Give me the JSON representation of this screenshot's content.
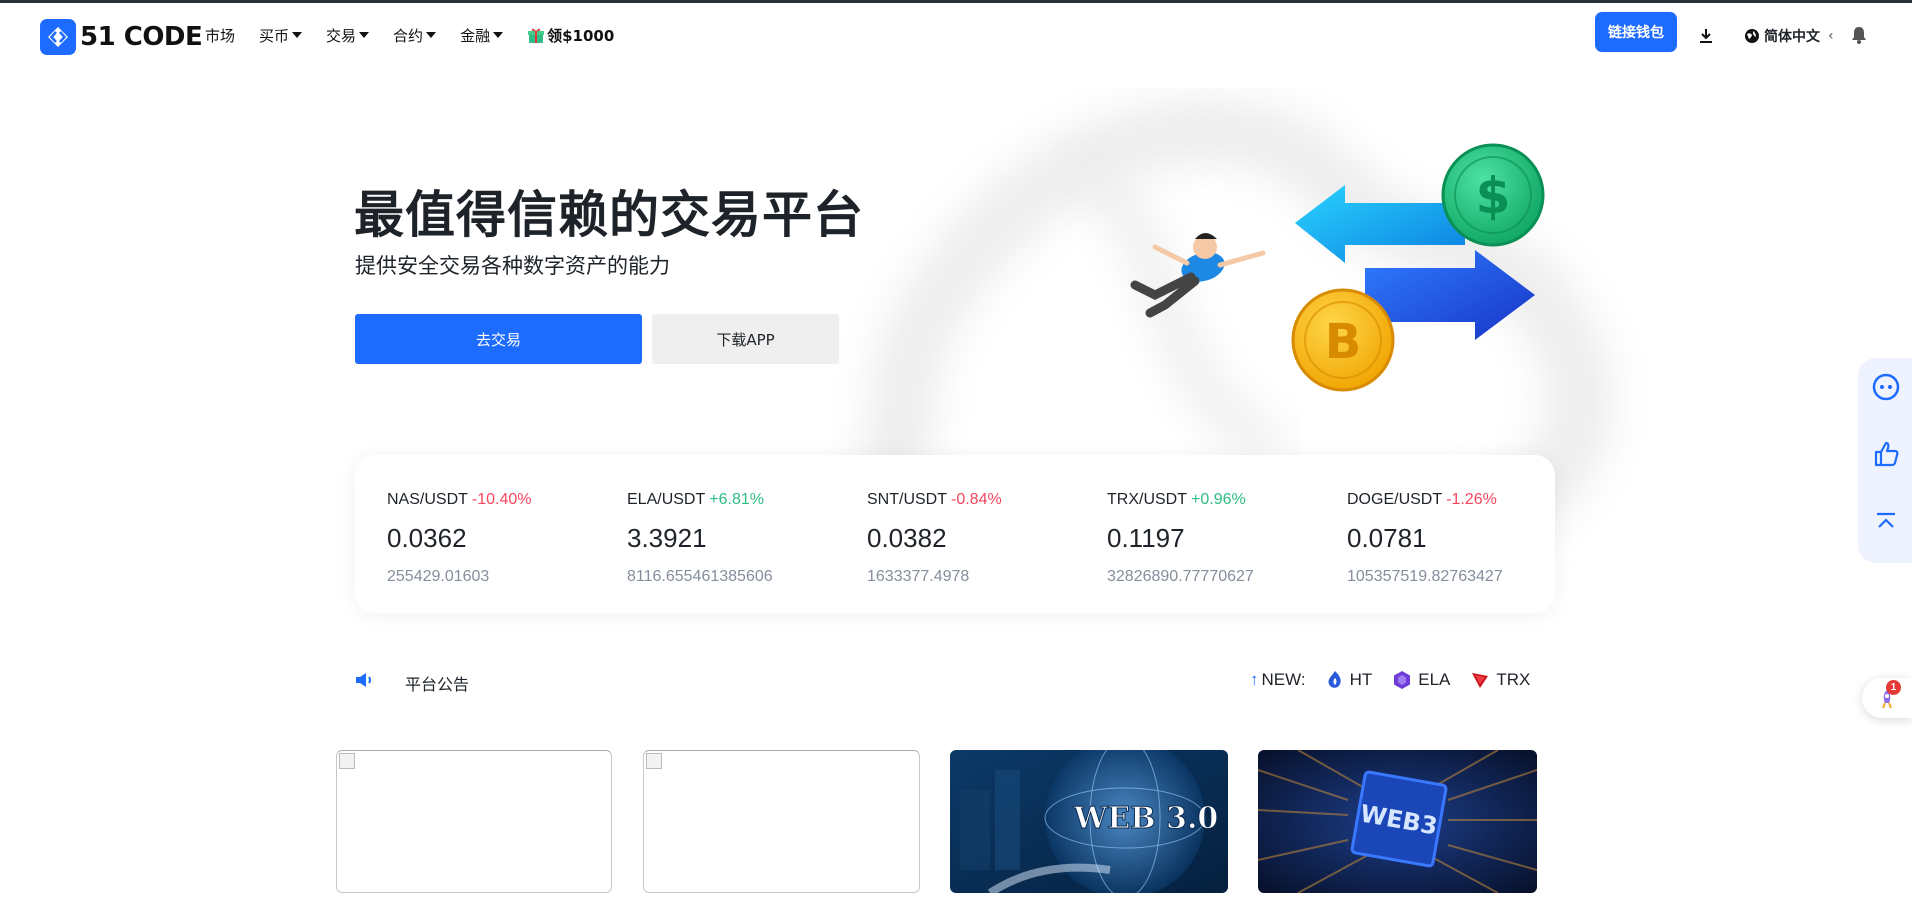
{
  "header": {
    "logo_text": "51 CODE",
    "nav": [
      {
        "label": "市场",
        "dropdown": false
      },
      {
        "label": "买币",
        "dropdown": true
      },
      {
        "label": "交易",
        "dropdown": true
      },
      {
        "label": "合约",
        "dropdown": true
      },
      {
        "label": "金融",
        "dropdown": true
      }
    ],
    "promo_label": "领$1000",
    "connect_wallet": "链接钱包",
    "language": "简体中文",
    "language_arrow": "‹"
  },
  "hero": {
    "title": "最值得信赖的交易平台",
    "subtitle": "提供安全交易各种数字资产的能力",
    "primary_button": "去交易",
    "secondary_button": "下载APP"
  },
  "tickers": [
    {
      "pair": "NAS/USDT",
      "change": "-10.40%",
      "direction": "down",
      "price": "0.0362",
      "volume": "255429.01603"
    },
    {
      "pair": "ELA/USDT",
      "change": "+6.81%",
      "direction": "up",
      "price": "3.3921",
      "volume": "8116.655461385606"
    },
    {
      "pair": "SNT/USDT",
      "change": "-0.84%",
      "direction": "down",
      "price": "0.0382",
      "volume": "1633377.4978"
    },
    {
      "pair": "TRX/USDT",
      "change": "+0.96%",
      "direction": "up",
      "price": "0.1197",
      "volume": "32826890.77770627"
    },
    {
      "pair": "DOGE/USDT",
      "change": "-1.26%",
      "direction": "down",
      "price": "0.0781",
      "volume": "105357519.82763427"
    }
  ],
  "announcement": {
    "label": "平台公告",
    "new_label": "NEW:",
    "new_coins": [
      "HT",
      "ELA",
      "TRX"
    ]
  },
  "cards": [
    {
      "type": "broken-image"
    },
    {
      "type": "broken-image"
    },
    {
      "type": "image",
      "text": "WEB 3.0"
    },
    {
      "type": "image",
      "text": "WEB3"
    }
  ],
  "floating": {
    "badge_count": "1"
  },
  "colors": {
    "accent": "#1e6bff",
    "up": "#2ebd85",
    "down": "#f6465d",
    "text": "#1e2329",
    "muted": "#848e9c"
  },
  "icons": [
    "logo-icon",
    "gift-icon",
    "download-icon",
    "globe-icon",
    "bell-icon",
    "megaphone-icon",
    "ht-coin-icon",
    "ela-coin-icon",
    "trx-coin-icon",
    "chat-bot-icon",
    "thumbs-up-icon",
    "back-to-top-icon",
    "rocket-icon"
  ]
}
